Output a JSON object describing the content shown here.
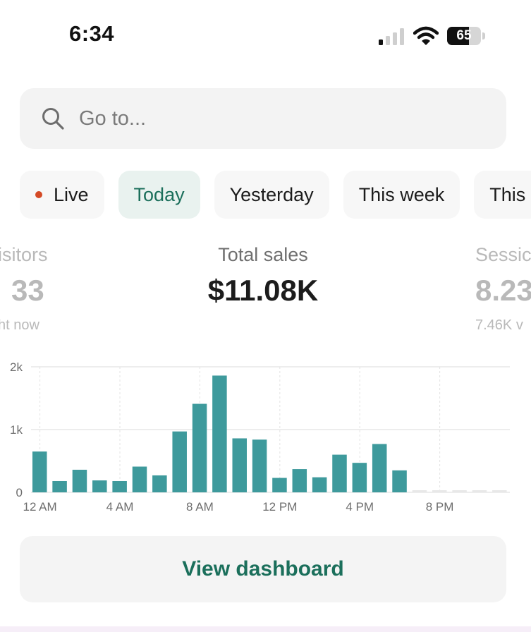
{
  "status_bar": {
    "time": "6:34",
    "battery_percent": "65",
    "battery_level": 0.65,
    "signal_bars_active": 1,
    "signal_bars_total": 4
  },
  "search": {
    "placeholder": "Go to..."
  },
  "tabs": [
    {
      "label": "Live",
      "active": false,
      "live_dot": true
    },
    {
      "label": "Today",
      "active": true
    },
    {
      "label": "Yesterday",
      "active": false
    },
    {
      "label": "This week",
      "active": false
    },
    {
      "label": "This",
      "active": false
    }
  ],
  "metrics": {
    "left": {
      "label": "isitors",
      "value": "33",
      "sub": "ht now"
    },
    "center": {
      "label": "Total sales",
      "value": "$11.08K"
    },
    "right": {
      "label": "Sessic",
      "value": "8.23",
      "sub": "7.46K v"
    }
  },
  "colors": {
    "accent": "#1b6f5b",
    "bar": "#3e9a9c",
    "live": "#d44a26"
  },
  "chart_data": {
    "type": "bar",
    "ylim": [
      0,
      2000
    ],
    "yticks": [
      {
        "value": 0,
        "label": "0"
      },
      {
        "value": 1000,
        "label": "1k"
      },
      {
        "value": 2000,
        "label": "2k"
      }
    ],
    "xticks": [
      {
        "hour": 0,
        "label": "12 AM"
      },
      {
        "hour": 4,
        "label": "4 AM"
      },
      {
        "hour": 8,
        "label": "8 AM"
      },
      {
        "hour": 12,
        "label": "12 PM"
      },
      {
        "hour": 16,
        "label": "4 PM"
      },
      {
        "hour": 20,
        "label": "8 PM"
      }
    ],
    "values": [
      650,
      180,
      360,
      190,
      180,
      410,
      270,
      970,
      1410,
      1860,
      860,
      840,
      230,
      370,
      240,
      600,
      470,
      770,
      350,
      0,
      0,
      0,
      0,
      0
    ],
    "pending_from_hour": 19,
    "grid": true
  },
  "button": {
    "label": "View dashboard"
  }
}
